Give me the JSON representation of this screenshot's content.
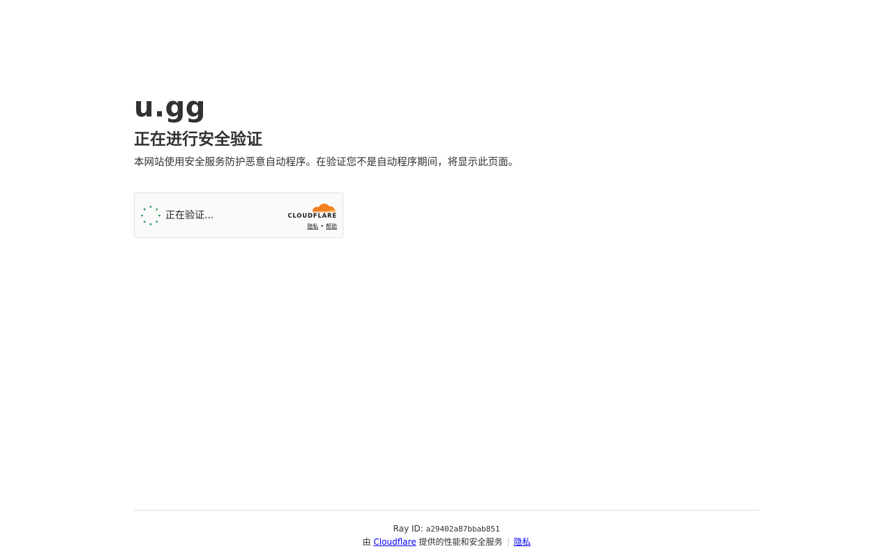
{
  "site": {
    "domain": "u.gg"
  },
  "challenge": {
    "heading": "正在进行安全验证",
    "description": "本网站使用安全服务防护恶意自动程序。在验证您不是自动程序期间，将显示此页面。"
  },
  "widget": {
    "status_text": "正在验证...",
    "brand_text": "CLOUDFLARE",
    "privacy_link": "隐私",
    "separator": "•",
    "help_link": "帮助",
    "spinner_icon": "loading-spinner-icon",
    "logo_icon": "cloudflare-cloud-icon",
    "accent_color": "#f38020",
    "spinner_color": "#2f9e5a"
  },
  "footer": {
    "ray_label": "Ray ID:",
    "ray_id": "a29402a87bbab851",
    "perf_prefix": "由",
    "perf_link": "Cloudflare",
    "perf_suffix": "提供的性能和安全服务",
    "divider": "|",
    "privacy_link": "隐私"
  }
}
